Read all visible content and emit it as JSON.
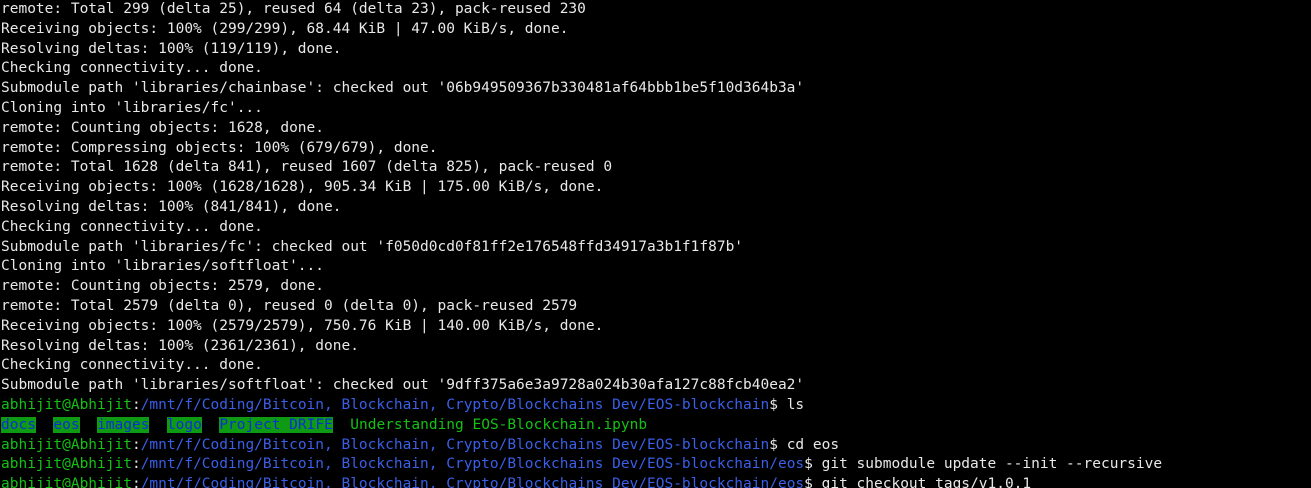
{
  "output_lines": [
    "remote: Total 299 (delta 25), reused 64 (delta 23), pack-reused 230",
    "Receiving objects: 100% (299/299), 68.44 KiB | 47.00 KiB/s, done.",
    "Resolving deltas: 100% (119/119), done.",
    "Checking connectivity... done.",
    "Submodule path 'libraries/chainbase': checked out '06b949509367b330481af64bbb1be5f10d364b3a'",
    "Cloning into 'libraries/fc'...",
    "remote: Counting objects: 1628, done.",
    "remote: Compressing objects: 100% (679/679), done.",
    "remote: Total 1628 (delta 841), reused 1607 (delta 825), pack-reused 0",
    "Receiving objects: 100% (1628/1628), 905.34 KiB | 175.00 KiB/s, done.",
    "Resolving deltas: 100% (841/841), done.",
    "Checking connectivity... done.",
    "Submodule path 'libraries/fc': checked out 'f050d0cd0f81ff2e176548ffd34917a3b1f1f87b'",
    "Cloning into 'libraries/softfloat'...",
    "remote: Counting objects: 2579, done.",
    "remote: Total 2579 (delta 0), reused 0 (delta 0), pack-reused 2579",
    "Receiving objects: 100% (2579/2579), 750.76 KiB | 140.00 KiB/s, done.",
    "Resolving deltas: 100% (2361/2361), done.",
    "Checking connectivity... done.",
    "Submodule path 'libraries/softfloat': checked out '9dff375a6e3a9728a024b30afa127c88fcb40ea2'"
  ],
  "prompts": [
    {
      "user": "abhijit@Abhijit",
      "sep": ":",
      "path": "/mnt/f/Coding/Bitcoin, Blockchain, Crypto/Blockchains Dev/EOS-blockchain",
      "symbol": "$ ",
      "command": "ls"
    },
    {
      "user": "abhijit@Abhijit",
      "sep": ":",
      "path": "/mnt/f/Coding/Bitcoin, Blockchain, Crypto/Blockchains Dev/EOS-blockchain",
      "symbol": "$ ",
      "command": "cd eos"
    },
    {
      "user": "abhijit@Abhijit",
      "sep": ":",
      "path": "/mnt/f/Coding/Bitcoin, Blockchain, Crypto/Blockchains Dev/EOS-blockchain/eos",
      "symbol": "$ ",
      "command": "git submodule update --init --recursive"
    },
    {
      "user": "abhijit@Abhijit",
      "sep": ":",
      "path": "/mnt/f/Coding/Bitcoin, Blockchain, Crypto/Blockchains Dev/EOS-blockchain/eos",
      "symbol": "$ ",
      "command": "git checkout tags/v1.0.1"
    }
  ],
  "ls_listing": {
    "dirs": [
      "docs",
      "eos",
      "images",
      "logo",
      "Project DRIFE"
    ],
    "file": "Understanding EOS-Blockchain.ipynb"
  },
  "colors": {
    "background": "#000000",
    "text": "#e8e8e8",
    "user": "#13c213",
    "path": "#3a5fe8",
    "dir_bg": "#0e9a12",
    "dir_fg": "#0a2fd8"
  }
}
